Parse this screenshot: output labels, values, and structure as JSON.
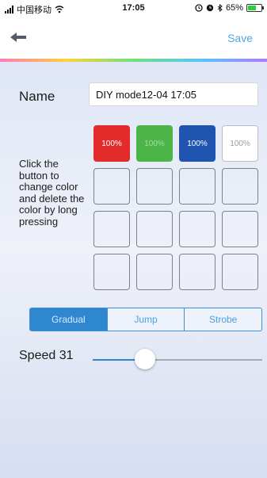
{
  "status_bar": {
    "carrier": "中国移动",
    "time": "17:05",
    "battery": "65%",
    "battery_level": 0.65,
    "icons": [
      "signal-icon",
      "wifi-icon",
      "alarm-icon",
      "clock-icon",
      "bluetooth-icon",
      "battery-icon"
    ]
  },
  "nav": {
    "save_label": "Save",
    "back_icon": "back-arrow-icon",
    "accent_color": "#4fa6e6"
  },
  "form": {
    "name_label": "Name",
    "name_value": "DIY mode12-04 17:05"
  },
  "instructions": "Click the button to change color and delete the color by long pressing",
  "color_grid": {
    "rows": 4,
    "cols": 4,
    "swatches": [
      {
        "label": "100%",
        "color": "#e32b2b",
        "text_color": "#ffffff"
      },
      {
        "label": "100%",
        "color": "#4cb548",
        "text_color": "#a7dba0"
      },
      {
        "label": "100%",
        "color": "#1f55b0",
        "text_color": "#ffffff"
      },
      {
        "label": "100%",
        "color": "#ffffff",
        "text_color": "#9b9b9b"
      }
    ]
  },
  "modes": {
    "options": [
      "Gradual",
      "Jump",
      "Strobe"
    ],
    "selected_index": 0,
    "active_color": "#2f88cf"
  },
  "speed": {
    "label": "Speed 31",
    "value": 31,
    "max": 100
  }
}
